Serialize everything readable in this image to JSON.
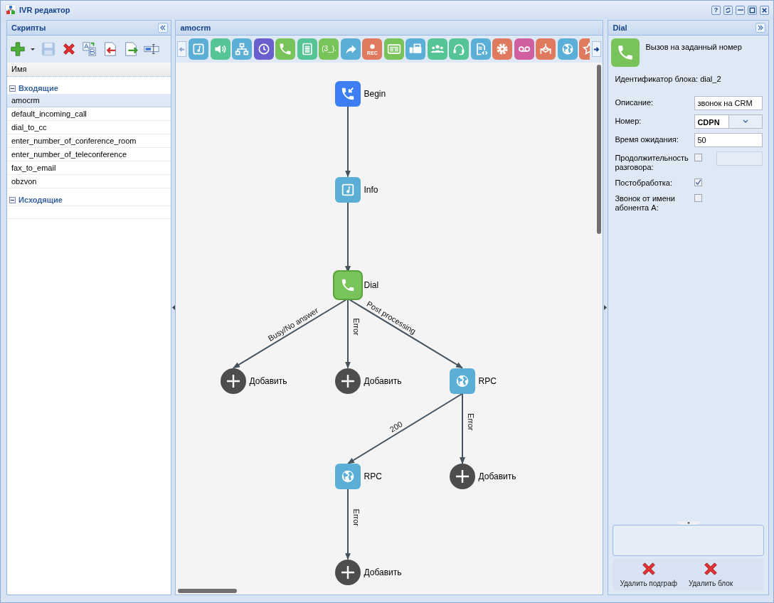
{
  "window": {
    "title": "IVR редактор",
    "controls": [
      {
        "kind": "help",
        "label": "?"
      },
      {
        "kind": "refresh"
      },
      {
        "kind": "minimize"
      },
      {
        "kind": "maximize"
      },
      {
        "kind": "close"
      }
    ]
  },
  "scripts_panel": {
    "title": "Скрипты",
    "toolbar": [
      {
        "kind": "add",
        "disabled": false
      },
      {
        "kind": "save",
        "disabled": true
      },
      {
        "kind": "delete",
        "disabled": false
      },
      {
        "kind": "rename",
        "disabled": false
      },
      {
        "kind": "import",
        "disabled": false
      },
      {
        "kind": "export",
        "disabled": false
      },
      {
        "kind": "field",
        "disabled": false
      }
    ],
    "column": "Имя",
    "groups": [
      {
        "label": "Входящие",
        "expanded": true,
        "items": [
          {
            "name": "amocrm",
            "selected": true
          },
          {
            "name": "default_incoming_call",
            "selected": false
          },
          {
            "name": "dial_to_cc",
            "selected": false
          },
          {
            "name": "enter_number_of_conference_room",
            "selected": false
          },
          {
            "name": "enter_number_of_teleconference",
            "selected": false
          },
          {
            "name": "fax_to_email",
            "selected": false
          },
          {
            "name": "obzvon",
            "selected": false
          }
        ]
      },
      {
        "label": "Исходящие",
        "expanded": true
      }
    ]
  },
  "editor": {
    "title": "amocrm",
    "palette": [
      {
        "kind": "note",
        "color": "#5bafd6"
      },
      {
        "kind": "speaker",
        "color": "#55c595"
      },
      {
        "kind": "hierarchy",
        "color": "#5bafd6"
      },
      {
        "kind": "clock",
        "color": "#6a5fcf"
      },
      {
        "kind": "phone",
        "color": "#79c35b"
      },
      {
        "kind": "document",
        "color": "#55c595"
      },
      {
        "kind": "text",
        "color": "#79c35b",
        "label": "(3_)."
      },
      {
        "kind": "share",
        "color": "#5bafd6"
      },
      {
        "kind": "record",
        "color": "#e07a5f",
        "label": "REC"
      },
      {
        "kind": "card",
        "color": "#79c35b"
      },
      {
        "kind": "printer",
        "color": "#5bafd6"
      },
      {
        "kind": "people",
        "color": "#55c595"
      },
      {
        "kind": "headset",
        "color": "#55c595"
      },
      {
        "kind": "code-document",
        "color": "#5bafd6"
      },
      {
        "kind": "gear",
        "color": "#e07a5f"
      },
      {
        "kind": "voicemail",
        "color": "#d05fa0"
      },
      {
        "kind": "hook",
        "color": "#e07a5f"
      },
      {
        "kind": "globe",
        "color": "#5bafd6"
      },
      {
        "kind": "star",
        "color": "#e07a5f"
      }
    ],
    "diagram": {
      "kind": "start",
      "color": "#3d7ef5",
      "label": "Begin",
      "selected": false,
      "children": [
        {
          "kind": "message",
          "color": "#5bafd6",
          "label": "Info",
          "selected": false,
          "children": [
            {
              "kind": "call",
              "color": "#79c35b",
              "label": "Dial",
              "selected": true,
              "children": [
                {
                  "edge_label": "Busy/No answer",
                  "kind": "add",
                  "label": "Добавить"
                },
                {
                  "edge_label": "Error",
                  "kind": "add",
                  "label": "Добавить"
                },
                {
                  "edge_label": "Post processing",
                  "kind": "request",
                  "color": "#5bafd6",
                  "label": "RPC",
                  "selected": false,
                  "children": [
                    {
                      "edge_label": "200",
                      "kind": "request",
                      "color": "#5bafd6",
                      "label": "RPC",
                      "selected": false,
                      "children": [
                        {
                          "edge_label": "Error",
                          "kind": "add",
                          "label": "Добавить"
                        }
                      ]
                    },
                    {
                      "edge_label": "Error",
                      "kind": "add",
                      "label": "Добавить"
                    }
                  ]
                }
              ]
            }
          ]
        }
      ]
    }
  },
  "properties": {
    "title": "Dial",
    "kind": "call",
    "description": "Вызов на заданный номер",
    "block_id": "Идентификатор блока: dial_2",
    "fields": [
      {
        "kind": "text",
        "label": "Описание:",
        "value": "звонок на CRM"
      },
      {
        "kind": "select",
        "label": "Номер:",
        "value": "CDPN"
      },
      {
        "kind": "text",
        "label": "Время ожидания:",
        "value": "50"
      },
      {
        "kind": "check_input",
        "label": "Продолжительность разговора:",
        "checked": false
      },
      {
        "kind": "check",
        "label": "Постобработка:",
        "checked": true
      },
      {
        "kind": "check",
        "label": "Звонок от имени абонента А:",
        "checked": false
      }
    ],
    "actions": [
      {
        "label": "Удалить подграф"
      },
      {
        "label": "Удалить блок"
      }
    ]
  }
}
